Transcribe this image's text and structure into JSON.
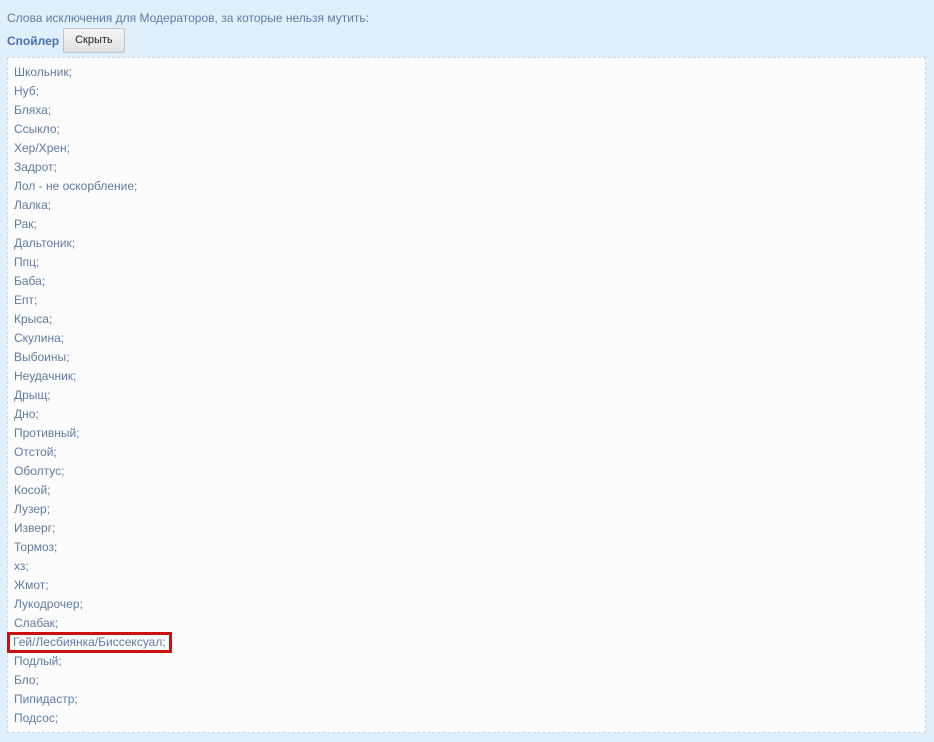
{
  "intro_text": "Слова исключения для Модераторов, за которые нельзя мутить:",
  "spoiler": {
    "title": "Спойлер",
    "toggle_label": "Скрыть"
  },
  "words": [
    "Школьник;",
    "Нуб;",
    "Бляха;",
    "Ссыкло;",
    "Хер/Хрен;",
    "Задрот;",
    "Лол - не оскорбление;",
    "Лалка;",
    "Рак;",
    "Дальтоник;",
    "Ппц;",
    "Баба;",
    "Епт;",
    "Крыса;",
    "Скулина;",
    "Выбоины;",
    "Неудачник;",
    "Дрыщ;",
    "Дно;",
    "Противный;",
    "Отстой;",
    "Оболтус;",
    "Косой;",
    "Лузер;",
    "Изверг;",
    "Тормоз;",
    "хз;",
    "Жмот;",
    "Лукодрочер;",
    "Слабак;",
    "Гей/Лесбиянка/Биссексуал;",
    "Подлый;",
    "Бло;",
    "Пипидастр;",
    "Подсос;"
  ],
  "highlight_index": 30,
  "colors": {
    "background": "#dfeffc",
    "text": "#5f7ca3",
    "highlight_border": "#cc1111"
  }
}
